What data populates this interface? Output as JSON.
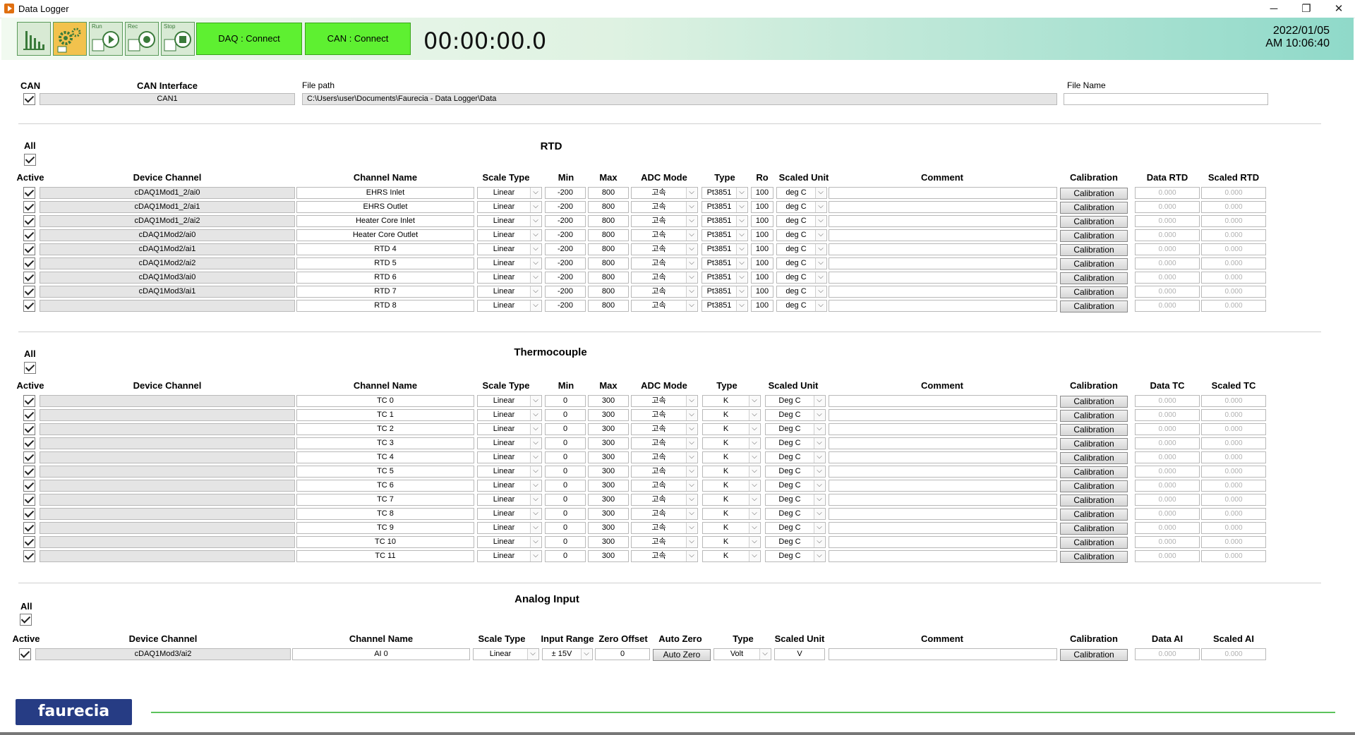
{
  "window": {
    "title": "Data Logger"
  },
  "toolbar": {
    "icons": [
      {
        "name": "chart-icon",
        "caption": ""
      },
      {
        "name": "settings-icon",
        "caption": ""
      },
      {
        "name": "run-icon",
        "caption": "Run"
      },
      {
        "name": "rec-icon",
        "caption": "Rec"
      },
      {
        "name": "stop-icon",
        "caption": "Stop"
      }
    ],
    "daq_label": "DAQ : Connect",
    "can_label": "CAN : Connect",
    "timer": "00:00:00.0",
    "date": "2022/01/05",
    "time": "AM 10:06:40"
  },
  "can": {
    "can_label": "CAN",
    "interface_label": "CAN Interface",
    "interface_value": "CAN1",
    "file_path_label": "File path",
    "file_path_value": "C:\\Users\\user\\Documents\\Faurecia - Data Logger\\Data",
    "file_name_label": "File Name",
    "file_name_value": ""
  },
  "rtd": {
    "title": "RTD",
    "all_label": "All",
    "headers": {
      "active": "Active",
      "device_channel": "Device Channel",
      "channel_name": "Channel Name",
      "scale_type": "Scale Type",
      "min": "Min",
      "max": "Max",
      "adc_mode": "ADC Mode",
      "type": "Type",
      "ro": "Ro",
      "scaled_unit": "Scaled Unit",
      "comment": "Comment",
      "calibration": "Calibration",
      "data": "Data RTD",
      "scaled": "Scaled RTD"
    },
    "rows": [
      {
        "device": "cDAQ1Mod1_2/ai0",
        "name": "EHRS Inlet",
        "scale": "Linear",
        "min": "-200",
        "max": "800",
        "adc": "고속",
        "type": "Pt3851",
        "ro": "100",
        "unit": "deg C",
        "comment": "",
        "cal": "Calibration",
        "data": "0.000",
        "scaled": "0.000"
      },
      {
        "device": "cDAQ1Mod1_2/ai1",
        "name": "EHRS Outlet",
        "scale": "Linear",
        "min": "-200",
        "max": "800",
        "adc": "고속",
        "type": "Pt3851",
        "ro": "100",
        "unit": "deg C",
        "comment": "",
        "cal": "Calibration",
        "data": "0.000",
        "scaled": "0.000"
      },
      {
        "device": "cDAQ1Mod1_2/ai2",
        "name": "Heater Core Inlet",
        "scale": "Linear",
        "min": "-200",
        "max": "800",
        "adc": "고속",
        "type": "Pt3851",
        "ro": "100",
        "unit": "deg C",
        "comment": "",
        "cal": "Calibration",
        "data": "0.000",
        "scaled": "0.000"
      },
      {
        "device": "cDAQ1Mod2/ai0",
        "name": "Heater Core Outlet",
        "scale": "Linear",
        "min": "-200",
        "max": "800",
        "adc": "고속",
        "type": "Pt3851",
        "ro": "100",
        "unit": "deg C",
        "comment": "",
        "cal": "Calibration",
        "data": "0.000",
        "scaled": "0.000"
      },
      {
        "device": "cDAQ1Mod2/ai1",
        "name": "RTD 4",
        "scale": "Linear",
        "min": "-200",
        "max": "800",
        "adc": "고속",
        "type": "Pt3851",
        "ro": "100",
        "unit": "deg C",
        "comment": "",
        "cal": "Calibration",
        "data": "0.000",
        "scaled": "0.000"
      },
      {
        "device": "cDAQ1Mod2/ai2",
        "name": "RTD 5",
        "scale": "Linear",
        "min": "-200",
        "max": "800",
        "adc": "고속",
        "type": "Pt3851",
        "ro": "100",
        "unit": "deg C",
        "comment": "",
        "cal": "Calibration",
        "data": "0.000",
        "scaled": "0.000"
      },
      {
        "device": "cDAQ1Mod3/ai0",
        "name": "RTD 6",
        "scale": "Linear",
        "min": "-200",
        "max": "800",
        "adc": "고속",
        "type": "Pt3851",
        "ro": "100",
        "unit": "deg C",
        "comment": "",
        "cal": "Calibration",
        "data": "0.000",
        "scaled": "0.000"
      },
      {
        "device": "cDAQ1Mod3/ai1",
        "name": "RTD 7",
        "scale": "Linear",
        "min": "-200",
        "max": "800",
        "adc": "고속",
        "type": "Pt3851",
        "ro": "100",
        "unit": "deg C",
        "comment": "",
        "cal": "Calibration",
        "data": "0.000",
        "scaled": "0.000"
      },
      {
        "device": "",
        "name": "RTD 8",
        "scale": "Linear",
        "min": "-200",
        "max": "800",
        "adc": "고속",
        "type": "Pt3851",
        "ro": "100",
        "unit": "deg C",
        "comment": "",
        "cal": "Calibration",
        "data": "0.000",
        "scaled": "0.000"
      }
    ]
  },
  "tc": {
    "title": "Thermocouple",
    "all_label": "All",
    "headers": {
      "active": "Active",
      "device_channel": "Device Channel",
      "channel_name": "Channel Name",
      "scale_type": "Scale Type",
      "min": "Min",
      "max": "Max",
      "adc_mode": "ADC Mode",
      "type": "Type",
      "scaled_unit": "Scaled Unit",
      "comment": "Comment",
      "calibration": "Calibration",
      "data": "Data TC",
      "scaled": "Scaled TC"
    },
    "rows": [
      {
        "device": "",
        "name": "TC 0",
        "scale": "Linear",
        "min": "0",
        "max": "300",
        "adc": "고속",
        "type": "K",
        "unit": "Deg C",
        "comment": "",
        "cal": "Calibration",
        "data": "0.000",
        "scaled": "0.000"
      },
      {
        "device": "",
        "name": "TC 1",
        "scale": "Linear",
        "min": "0",
        "max": "300",
        "adc": "고속",
        "type": "K",
        "unit": "Deg C",
        "comment": "",
        "cal": "Calibration",
        "data": "0.000",
        "scaled": "0.000"
      },
      {
        "device": "",
        "name": "TC 2",
        "scale": "Linear",
        "min": "0",
        "max": "300",
        "adc": "고속",
        "type": "K",
        "unit": "Deg C",
        "comment": "",
        "cal": "Calibration",
        "data": "0.000",
        "scaled": "0.000"
      },
      {
        "device": "",
        "name": "TC 3",
        "scale": "Linear",
        "min": "0",
        "max": "300",
        "adc": "고속",
        "type": "K",
        "unit": "Deg C",
        "comment": "",
        "cal": "Calibration",
        "data": "0.000",
        "scaled": "0.000"
      },
      {
        "device": "",
        "name": "TC 4",
        "scale": "Linear",
        "min": "0",
        "max": "300",
        "adc": "고속",
        "type": "K",
        "unit": "Deg C",
        "comment": "",
        "cal": "Calibration",
        "data": "0.000",
        "scaled": "0.000"
      },
      {
        "device": "",
        "name": "TC 5",
        "scale": "Linear",
        "min": "0",
        "max": "300",
        "adc": "고속",
        "type": "K",
        "unit": "Deg C",
        "comment": "",
        "cal": "Calibration",
        "data": "0.000",
        "scaled": "0.000"
      },
      {
        "device": "",
        "name": "TC 6",
        "scale": "Linear",
        "min": "0",
        "max": "300",
        "adc": "고속",
        "type": "K",
        "unit": "Deg C",
        "comment": "",
        "cal": "Calibration",
        "data": "0.000",
        "scaled": "0.000"
      },
      {
        "device": "",
        "name": "TC 7",
        "scale": "Linear",
        "min": "0",
        "max": "300",
        "adc": "고속",
        "type": "K",
        "unit": "Deg C",
        "comment": "",
        "cal": "Calibration",
        "data": "0.000",
        "scaled": "0.000"
      },
      {
        "device": "",
        "name": "TC 8",
        "scale": "Linear",
        "min": "0",
        "max": "300",
        "adc": "고속",
        "type": "K",
        "unit": "Deg C",
        "comment": "",
        "cal": "Calibration",
        "data": "0.000",
        "scaled": "0.000"
      },
      {
        "device": "",
        "name": "TC 9",
        "scale": "Linear",
        "min": "0",
        "max": "300",
        "adc": "고속",
        "type": "K",
        "unit": "Deg C",
        "comment": "",
        "cal": "Calibration",
        "data": "0.000",
        "scaled": "0.000"
      },
      {
        "device": "",
        "name": "TC 10",
        "scale": "Linear",
        "min": "0",
        "max": "300",
        "adc": "고속",
        "type": "K",
        "unit": "Deg C",
        "comment": "",
        "cal": "Calibration",
        "data": "0.000",
        "scaled": "0.000"
      },
      {
        "device": "",
        "name": "TC 11",
        "scale": "Linear",
        "min": "0",
        "max": "300",
        "adc": "고속",
        "type": "K",
        "unit": "Deg C",
        "comment": "",
        "cal": "Calibration",
        "data": "0.000",
        "scaled": "0.000"
      }
    ]
  },
  "ai": {
    "title": "Analog Input",
    "all_label": "All",
    "headers": {
      "active": "Active",
      "device_channel": "Device Channel",
      "channel_name": "Channel Name",
      "scale_type": "Scale Type",
      "input_range": "Input Range",
      "zero_offset": "Zero Offset",
      "auto_zero": "Auto Zero",
      "type": "Type",
      "scaled_unit": "Scaled Unit",
      "comment": "Comment",
      "calibration": "Calibration",
      "data": "Data AI",
      "scaled": "Scaled AI"
    },
    "rows": [
      {
        "device": "cDAQ1Mod3/ai2",
        "name": "AI 0",
        "scale": "Linear",
        "range": "± 15V",
        "offset": "0",
        "auto_zero": "Auto Zero",
        "type": "Volt",
        "unit": "V",
        "comment": "",
        "cal": "Calibration",
        "data": "0.000",
        "scaled": "0.000"
      }
    ]
  },
  "footer": {
    "logo_text": "faurecia"
  },
  "colors": {
    "connect_green": "#5ef031",
    "logo_blue": "#263c84",
    "accent_line": "#5cc35c"
  }
}
